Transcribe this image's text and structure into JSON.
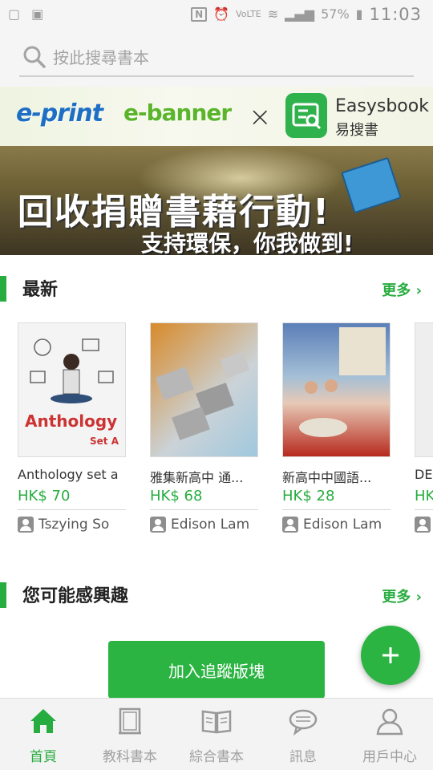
{
  "status_bar": {
    "left_icons": [
      "notification-icon",
      "image-icon"
    ],
    "time": "11:03",
    "battery": "57%"
  },
  "search": {
    "placeholder": "按此搜尋書本"
  },
  "banner": {
    "logo_eprint": "e-print",
    "logo_ebanner": "e-banner",
    "cross": "×",
    "brand": "Easysbook",
    "brand_sub": "易搜書",
    "headline": "回收捐贈書藉行動!",
    "subline": "支持環保，你我做到!"
  },
  "latest": {
    "title": "最新",
    "more": "更多 ›",
    "books": [
      {
        "title": "Anthology set a",
        "price": "HK$ 70",
        "seller": "Tszying So",
        "cover_text": "Anthology",
        "cover_sub": "Set A"
      },
      {
        "title": "雅集新高中 通...",
        "price": "HK$ 68",
        "seller": "Edison Lam"
      },
      {
        "title": "新高中中國語...",
        "price": "HK$ 28",
        "seller": "Edison Lam"
      },
      {
        "title": "DE",
        "price": "HK",
        "seller": ""
      }
    ]
  },
  "interest": {
    "title": "您可能感興趣",
    "more": "更多 ›"
  },
  "actions": {
    "track_button": "加入追蹤版塊",
    "fab": "+"
  },
  "nav": [
    {
      "label": "首頁",
      "icon": "home-icon",
      "active": true
    },
    {
      "label": "教科書本",
      "icon": "textbook-icon",
      "active": false
    },
    {
      "label": "綜合書本",
      "icon": "open-book-icon",
      "active": false
    },
    {
      "label": "訊息",
      "icon": "chat-icon",
      "active": false
    },
    {
      "label": "用戶中心",
      "icon": "user-icon",
      "active": false
    }
  ],
  "colors": {
    "accent": "#27ac3f",
    "inactive": "#a0a0a0"
  }
}
